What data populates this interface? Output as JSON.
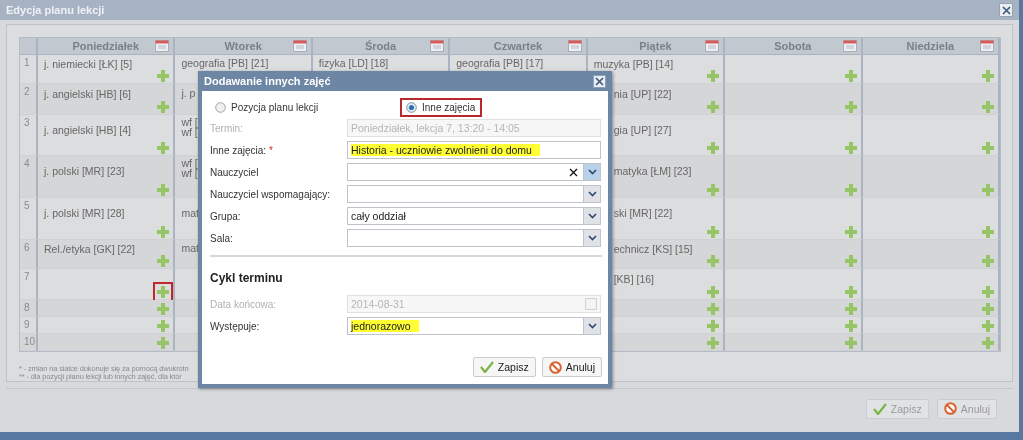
{
  "window": {
    "title": "Edycja planu lekcji"
  },
  "grid": {
    "columns": [
      {
        "label": "Poniedziałek"
      },
      {
        "label": "Wtorek"
      },
      {
        "label": "Środa"
      },
      {
        "label": "Czwartek"
      },
      {
        "label": "Piątek"
      },
      {
        "label": "Sobota"
      },
      {
        "label": "Niedziela"
      }
    ],
    "rows": [
      {
        "number": "1",
        "cells": [
          {
            "lines": [
              "j. niemiecki [ŁK] [5]"
            ],
            "plus": true
          },
          {
            "lines": [
              "geografia [PB] [21]"
            ],
            "plus": false
          },
          {
            "lines": [
              "fizyka [LD] [18]"
            ],
            "plus": false
          },
          {
            "lines": [
              "geografia [PB] [17]"
            ],
            "plus": false
          },
          {
            "lines": [
              "muzyka [PB] [14]"
            ],
            "plus": true
          },
          {
            "plus": true
          },
          {
            "plus": true
          }
        ]
      },
      {
        "number": "2",
        "cells": [
          {
            "lines": [
              "j. angielski [HB] [6]"
            ],
            "plus": true
          },
          {
            "lines": [
              "j. p"
            ],
            "plus": false
          },
          null,
          null,
          {
            "lines": [
              "nia [UP] [22]"
            ],
            "plus": true,
            "cut_left": true
          },
          {
            "plus": true
          },
          {
            "plus": true
          }
        ]
      },
      {
        "number": "3",
        "cells": [
          {
            "lines": [
              "j. angielski [HB] [4]"
            ],
            "plus": true
          },
          {
            "lines": [
              "wf [",
              "wf ["
            ],
            "plus": false
          },
          null,
          null,
          {
            "lines": [
              "gia [UP] [27]"
            ],
            "plus": true,
            "cut_left": true
          },
          {
            "plus": true
          },
          {
            "plus": true
          }
        ]
      },
      {
        "number": "4",
        "cells": [
          {
            "lines": [
              "j. polski [MR] [23]"
            ],
            "plus": true
          },
          {
            "lines": [
              "wf [",
              "wf ["
            ],
            "plus": false
          },
          null,
          null,
          {
            "lines": [
              "matyka [ŁM] [23]"
            ],
            "plus": true,
            "cut_left": true
          },
          {
            "plus": true
          },
          {
            "plus": true
          }
        ]
      },
      {
        "number": "5",
        "cells": [
          {
            "lines": [
              "j. polski [MR] [28]"
            ],
            "plus": true
          },
          {
            "lines": [
              "mat"
            ],
            "plus": false
          },
          null,
          null,
          {
            "lines": [
              "ski [MR] [22]"
            ],
            "plus": true,
            "cut_left": true
          },
          {
            "plus": true
          },
          {
            "plus": true
          }
        ]
      },
      {
        "number": "6",
        "cells": [
          {
            "lines": [
              "Rel./etyka [GK] [22]"
            ],
            "plus": true
          },
          {
            "lines": [
              "mat"
            ],
            "plus": false
          },
          null,
          null,
          {
            "lines": [
              "echnicz [KS] [15]"
            ],
            "plus": true,
            "cut_left": true
          },
          {
            "plus": true
          },
          {
            "plus": true
          }
        ]
      },
      {
        "number": "7",
        "cells": [
          {
            "plus": true,
            "marked": true
          },
          {
            "plus": false
          },
          null,
          null,
          {
            "lines": [
              "[KB] [16]"
            ],
            "plus": true,
            "cut_left": true
          },
          {
            "plus": true
          },
          {
            "plus": true
          }
        ]
      },
      {
        "number": "8",
        "cells": [
          {
            "plus": true
          },
          {
            "plus": false
          },
          null,
          null,
          {
            "plus": true
          },
          {
            "plus": true
          },
          {
            "plus": true
          }
        ]
      },
      {
        "number": "9",
        "cells": [
          {
            "plus": true
          },
          {
            "plus": false
          },
          null,
          null,
          {
            "plus": true
          },
          {
            "plus": true
          },
          {
            "plus": true
          }
        ]
      },
      {
        "number": "10",
        "cells": [
          {
            "plus": true
          },
          {
            "plus": false
          },
          null,
          null,
          {
            "plus": true
          },
          {
            "plus": true
          },
          {
            "plus": true
          }
        ]
      }
    ]
  },
  "footnotes": [
    "* - zmian na siatce dokonuje się za pomocą dwukrotn",
    "** - dla pozycji planu lekcji lub innych zajęć, dla któr"
  ],
  "footer_buttons": [
    {
      "label": "Zapisz",
      "kind": "save"
    },
    {
      "label": "Anuluj",
      "kind": "cancel"
    }
  ],
  "dialog": {
    "title": "Dodawanie innych zajęć",
    "radios": [
      {
        "label": "Pozycja planu lekcji",
        "selected": false,
        "outlined": false
      },
      {
        "label": "Inne zajęcia",
        "selected": true,
        "outlined": true
      }
    ],
    "fields": [
      {
        "kind": "readonly",
        "label": "Termin:",
        "value": "Poniedziałek, lekcja 7, 13:20 - 14:05"
      },
      {
        "kind": "text",
        "label": "Inne zajęcia:",
        "required_mark": "*",
        "value": "Historia - uczniowie zwolnieni do domu",
        "highlighted": true
      },
      {
        "kind": "combo",
        "label": "Nauczyciel",
        "clearable": true,
        "focused": true
      },
      {
        "kind": "combo",
        "label": "Nauczyciel wspomagający:",
        "clearable": false,
        "focused": false
      },
      {
        "kind": "combo",
        "label": "Grupa:",
        "value": "cały oddział",
        "clearable": false,
        "focused": false
      },
      {
        "kind": "combo",
        "label": "Sala:",
        "clearable": false,
        "focused": false
      }
    ],
    "section_title": "Cykl terminu",
    "cycle_fields": [
      {
        "kind": "date",
        "label": "Data końcowa:",
        "value": "2014-08-31"
      },
      {
        "kind": "combo",
        "label": "Występuje:",
        "value": "jednorazowo",
        "highlighted": true,
        "clearable": false,
        "focused": false
      }
    ],
    "buttons": [
      {
        "label": "Zapisz",
        "kind": "save"
      },
      {
        "label": "Anuluj",
        "kind": "cancel"
      }
    ]
  }
}
